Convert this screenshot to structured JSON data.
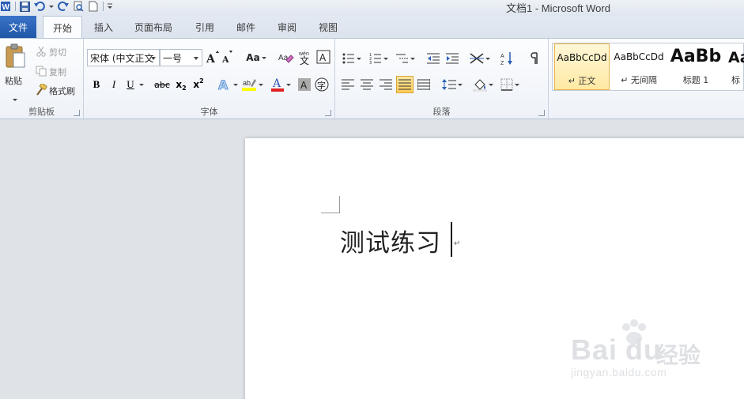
{
  "window": {
    "title": "文档1  -  Microsoft Word"
  },
  "tabs": [
    {
      "label": "文件"
    },
    {
      "label": "开始"
    },
    {
      "label": "插入"
    },
    {
      "label": "页面布局"
    },
    {
      "label": "引用"
    },
    {
      "label": "邮件"
    },
    {
      "label": "审阅"
    },
    {
      "label": "视图"
    }
  ],
  "clipboard": {
    "paste_label": "粘贴",
    "cut_label": "剪切",
    "copy_label": "复制",
    "format_painter_label": "格式刷",
    "group_label": "剪贴板"
  },
  "font": {
    "font_name": "宋体 (中文正文",
    "font_size": "一号",
    "case_label": "Aa",
    "group_label": "字体"
  },
  "paragraph": {
    "group_label": "段落"
  },
  "styles": [
    {
      "sample": "AaBbCcDd",
      "name": "↵ 正文"
    },
    {
      "sample": "AaBbCcDd",
      "name": "↵ 无间隔"
    },
    {
      "sample": "AaBb",
      "name": "标题 1"
    },
    {
      "sample": "Aa",
      "name": "标"
    }
  ],
  "document": {
    "text": "测试练习"
  },
  "watermark": {
    "brand": "Bai",
    "brand2": "du",
    "cn": "经验",
    "url": "jingyan.baidu.com"
  },
  "colors": {
    "file_tab": "#2a64b8",
    "highlight": "#ffff00",
    "font_color": "#e02020"
  }
}
